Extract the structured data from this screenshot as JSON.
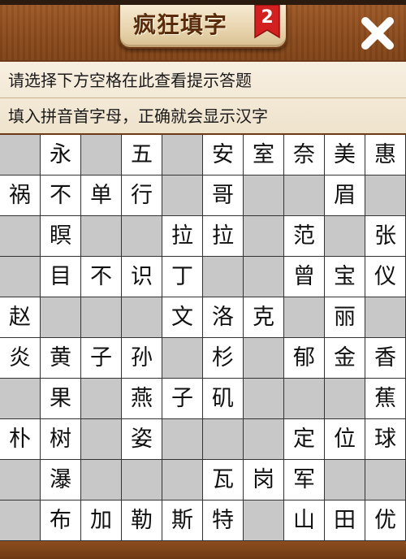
{
  "app": {
    "title": "疯狂填字",
    "level": "2"
  },
  "hints": {
    "line1": "请选择下方空格在此查看提示答题",
    "line2": "填入拼音首字母，正确就会显示汉字"
  },
  "icons": {
    "close": "close-icon"
  },
  "colors": {
    "wood": "#8a4a1c",
    "badge": "#d21f1f",
    "cell_white": "#ffffff",
    "cell_gray": "#c8c8c8"
  },
  "grid": {
    "rows": [
      [
        "#",
        "永",
        "#",
        "五",
        "#",
        "安",
        "室",
        "奈",
        "美",
        "惠"
      ],
      [
        "祸",
        "不",
        "单",
        "行",
        "#",
        "哥",
        "#",
        "#",
        "眉",
        "#"
      ],
      [
        "#",
        "瞑",
        "#",
        "#",
        "拉",
        "拉",
        "#",
        "范",
        "#",
        "张"
      ],
      [
        "#",
        "目",
        "不",
        "识",
        "丁",
        "#",
        "#",
        "曾",
        "宝",
        "仪"
      ],
      [
        "赵",
        "#",
        "#",
        "#",
        "文",
        "洛",
        "克",
        "#",
        "丽",
        "#"
      ],
      [
        "炎",
        "黄",
        "子",
        "孙",
        "#",
        "杉",
        "#",
        "郁",
        "金",
        "香"
      ],
      [
        "#",
        "果",
        "#",
        "燕",
        "子",
        "矶",
        "#",
        "#",
        "#",
        "蕉"
      ],
      [
        "朴",
        "树",
        "#",
        "姿",
        "#",
        "#",
        "#",
        "定",
        "位",
        "球"
      ],
      [
        "#",
        "瀑",
        "#",
        "#",
        "#",
        "瓦",
        "岗",
        "军",
        "#",
        "#"
      ],
      [
        "#",
        "布",
        "加",
        "勒",
        "斯",
        "特",
        "#",
        "山",
        "田",
        "优"
      ]
    ]
  }
}
